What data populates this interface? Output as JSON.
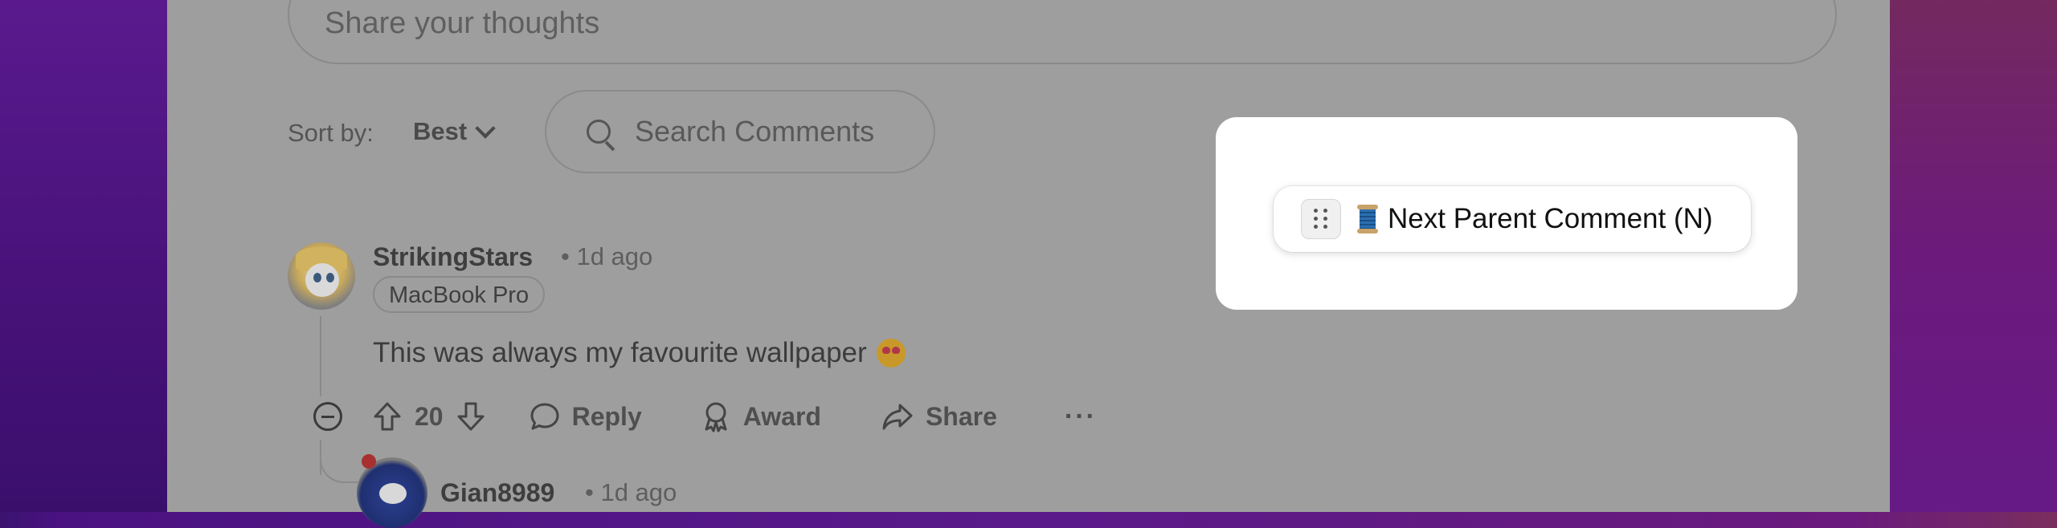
{
  "composer": {
    "placeholder": "Share your thoughts"
  },
  "sort": {
    "label": "Sort by:",
    "value": "Best"
  },
  "search": {
    "placeholder": "Search Comments"
  },
  "comments": [
    {
      "username": "StrikingStars",
      "meta": "• 1d ago",
      "flair": "MacBook Pro",
      "text": "This was always my favourite wallpaper",
      "emoji": "smiling-face-with-heart-eyes",
      "votes": "20",
      "actions": {
        "reply": "Reply",
        "award": "Award",
        "share": "Share",
        "more": "···"
      }
    },
    {
      "username": "Gian8989",
      "meta": "• 1d ago"
    }
  ],
  "shortcut": {
    "label": "Next Parent Comment (N)",
    "icon": "spool-of-thread-icon"
  }
}
